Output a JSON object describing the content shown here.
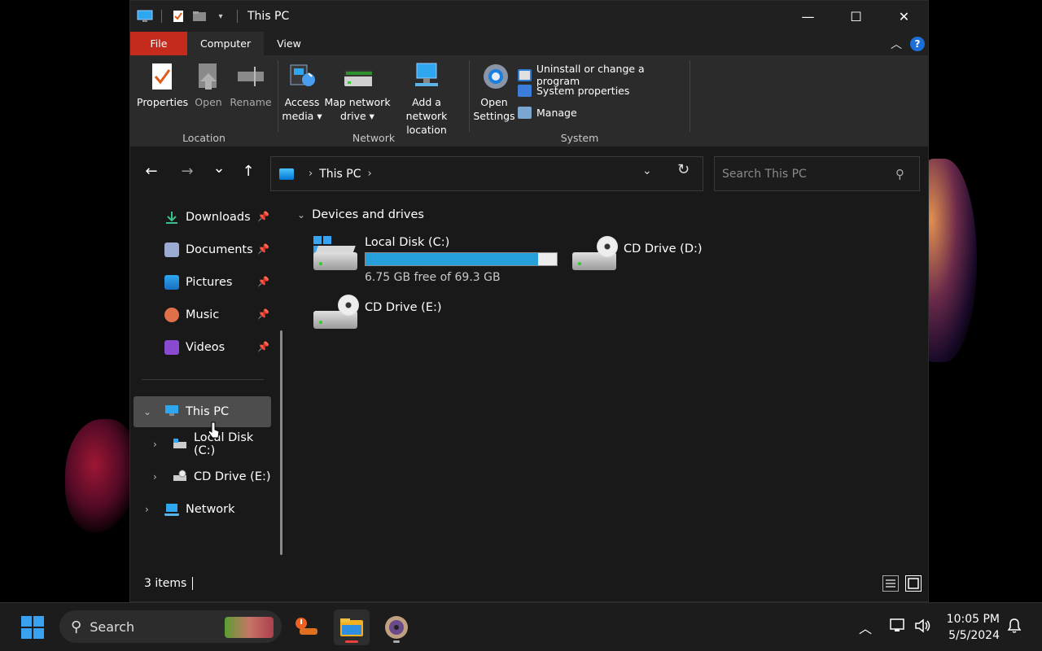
{
  "window": {
    "title": "This PC",
    "controls": {
      "minimize": "—",
      "maximize": "☐",
      "close": "✕"
    }
  },
  "ribbon": {
    "tabs": [
      {
        "label": "File"
      },
      {
        "label": "Computer"
      },
      {
        "label": "View"
      }
    ],
    "groups": {
      "location": {
        "label": "Location",
        "buttons": {
          "properties": "Properties",
          "open": "Open",
          "rename": "Rename"
        }
      },
      "network": {
        "label": "Network",
        "buttons": {
          "access_media_1": "Access",
          "access_media_2": "media ▾",
          "map_drive_1": "Map network",
          "map_drive_2": "drive ▾",
          "add_location_1": "Add a network",
          "add_location_2": "location"
        }
      },
      "system": {
        "label": "System",
        "open_settings_1": "Open",
        "open_settings_2": "Settings",
        "uninstall": "Uninstall or change a program",
        "system_properties": "System properties",
        "manage": "Manage"
      }
    }
  },
  "navbar": {
    "back": "←",
    "forward": "→",
    "recent": "⌄",
    "up": "↑",
    "breadcrumb": "This PC",
    "search_placeholder": "Search This PC"
  },
  "sidebar": {
    "quick_access": [
      {
        "label": "Downloads"
      },
      {
        "label": "Documents"
      },
      {
        "label": "Pictures"
      },
      {
        "label": "Music"
      },
      {
        "label": "Videos"
      }
    ],
    "this_pc": "This PC",
    "local_disk": "Local Disk (C:)",
    "cd_drive": "CD Drive (E:)",
    "network": "Network"
  },
  "content": {
    "group_title": "Devices and drives",
    "drives": {
      "c": {
        "name": "Local Disk (C:)",
        "free": "6.75 GB free of 69.3 GB",
        "used_fraction": 0.903
      },
      "d": {
        "name": "CD Drive (D:)"
      },
      "e": {
        "name": "CD Drive (E:)"
      }
    }
  },
  "status": {
    "items": "3 items"
  },
  "taskbar": {
    "search_label": "Search",
    "time": "10:05 PM",
    "date": "5/5/2024"
  },
  "colors": {
    "accent": "#26a0da",
    "file_tab": "#c42b1c",
    "selection": "#4d4d4d"
  }
}
